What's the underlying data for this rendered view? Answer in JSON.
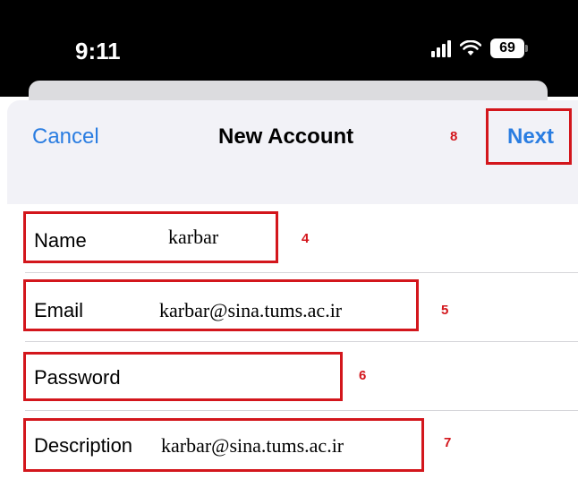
{
  "status_bar": {
    "time": "9:11",
    "battery": "69"
  },
  "nav": {
    "cancel_label": "Cancel",
    "title": "New Account",
    "next_label": "Next"
  },
  "form": {
    "fields": [
      {
        "label": "Name",
        "value": "karbar"
      },
      {
        "label": "Email",
        "value": "karbar@sina.tums.ac.ir"
      },
      {
        "label": "Password",
        "value": ""
      },
      {
        "label": "Description",
        "value": "karbar@sina.tums.ac.ir"
      }
    ]
  },
  "annotations": {
    "name": "4",
    "email": "5",
    "password": "6",
    "description": "7",
    "next": "8"
  },
  "colors": {
    "accent": "#2a7de1",
    "annotation": "#d3161c"
  }
}
